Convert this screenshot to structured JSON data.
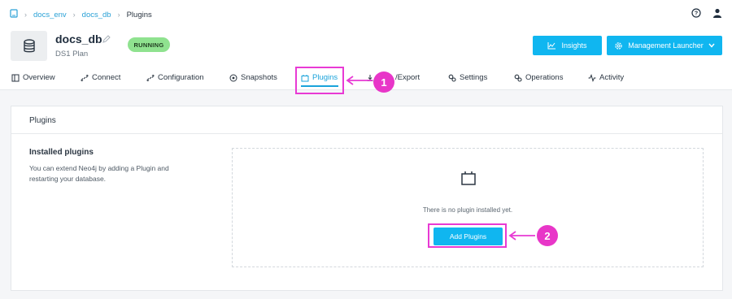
{
  "breadcrumb": {
    "items": [
      "docs_env",
      "docs_db"
    ],
    "current": "Plugins"
  },
  "header": {
    "db_name": "docs_db",
    "plan": "DS1 Plan",
    "status": "RUNNING",
    "insights_label": "Insights",
    "launcher_label": "Management Launcher"
  },
  "tabs": [
    {
      "label": "Overview",
      "icon": "overview-icon"
    },
    {
      "label": "Connect",
      "icon": "link-icon"
    },
    {
      "label": "Configuration",
      "icon": "link-icon"
    },
    {
      "label": "Snapshots",
      "icon": "snapshot-icon"
    },
    {
      "label": "Plugins",
      "icon": "plugin-icon",
      "active": true
    },
    {
      "label": "/Export",
      "icon": "download-icon"
    },
    {
      "label": "Settings",
      "icon": "gears-icon"
    },
    {
      "label": "Operations",
      "icon": "gears-icon"
    },
    {
      "label": "Activity",
      "icon": "activity-icon"
    }
  ],
  "panel": {
    "title": "Plugins",
    "installed_title": "Installed plugins",
    "installed_desc": "You can extend Neo4j by adding a Plugin and restarting your database.",
    "empty_text": "There is no plugin installed yet.",
    "add_label": "Add Plugins"
  },
  "annotations": {
    "step1": "1",
    "step2": "2"
  },
  "colors": {
    "accent": "#10b6f0",
    "status_green": "#8fe28f",
    "annotation": "#e83ad4"
  }
}
